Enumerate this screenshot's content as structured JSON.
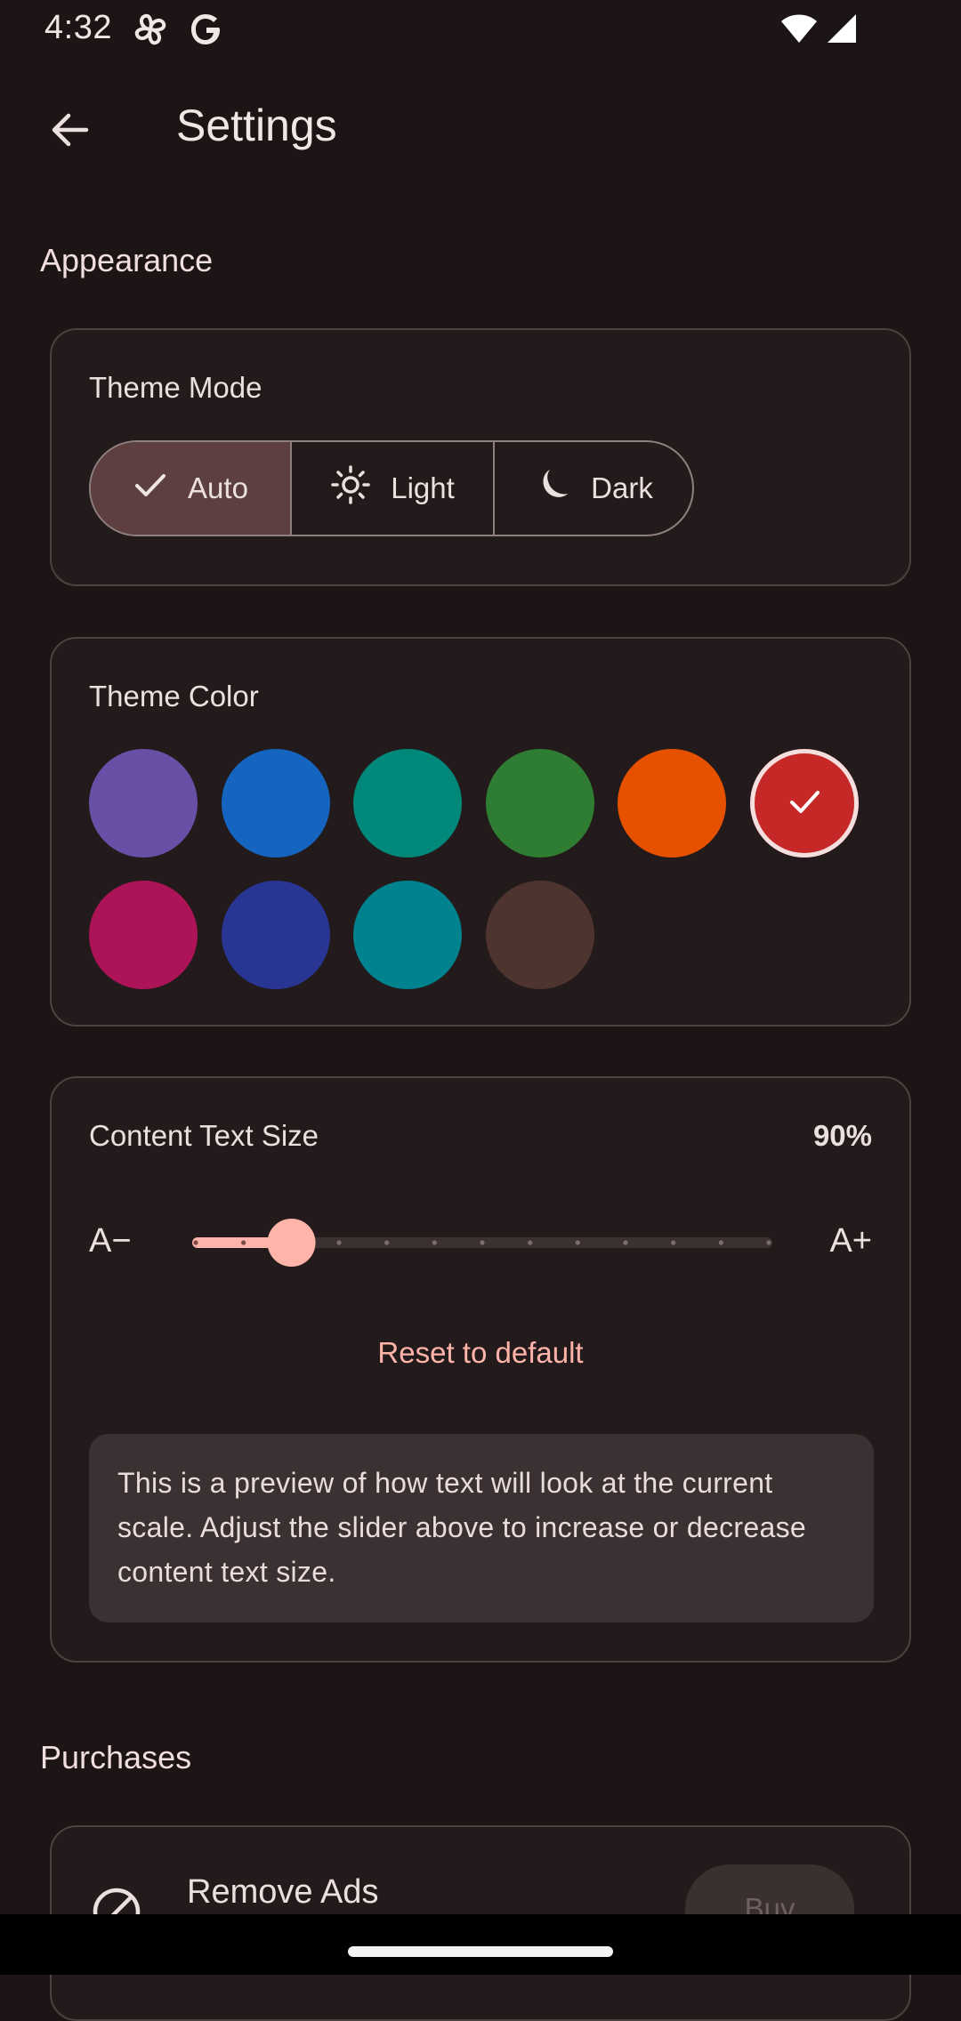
{
  "status_bar": {
    "time": "4:32",
    "left_icons": [
      "fan-icon",
      "google-icon"
    ],
    "right_icons": [
      "wifi-icon",
      "signal-icon"
    ]
  },
  "app_bar": {
    "back_icon": "arrow-back-icon",
    "title": "Settings"
  },
  "appearance": {
    "heading": "Appearance",
    "theme_mode": {
      "title": "Theme Mode",
      "options": [
        {
          "label": "Auto",
          "icon": "check-icon",
          "selected": true
        },
        {
          "label": "Light",
          "icon": "sun-icon",
          "selected": false
        },
        {
          "label": "Dark",
          "icon": "moon-icon",
          "selected": false
        }
      ]
    },
    "theme_color": {
      "title": "Theme Color",
      "colors": [
        "#6a4fa6",
        "#1565c0",
        "#00897b",
        "#2e7d32",
        "#e65100",
        "#c62828",
        "#ad1457",
        "#283593",
        "#00838f",
        "#4e342e"
      ],
      "selected_index": 5
    },
    "text_size": {
      "title": "Content Text Size",
      "value_label": "90%",
      "decrease_label": "A−",
      "increase_label": "A+",
      "slider_fraction": 0.167,
      "tick_count": 13,
      "reset_label": "Reset to default",
      "preview_text": "This is a preview of how text will look at the current scale. Adjust the slider above to increase or decrease content text size."
    }
  },
  "purchases": {
    "heading": "Purchases",
    "items": [
      {
        "icon": "block-icon",
        "label": "Remove Ads",
        "button_label": "Buy"
      }
    ]
  },
  "colors": {
    "accent": "#ffb4aa",
    "selected_segment": "#5d3f3f",
    "background": "#1c1415"
  }
}
